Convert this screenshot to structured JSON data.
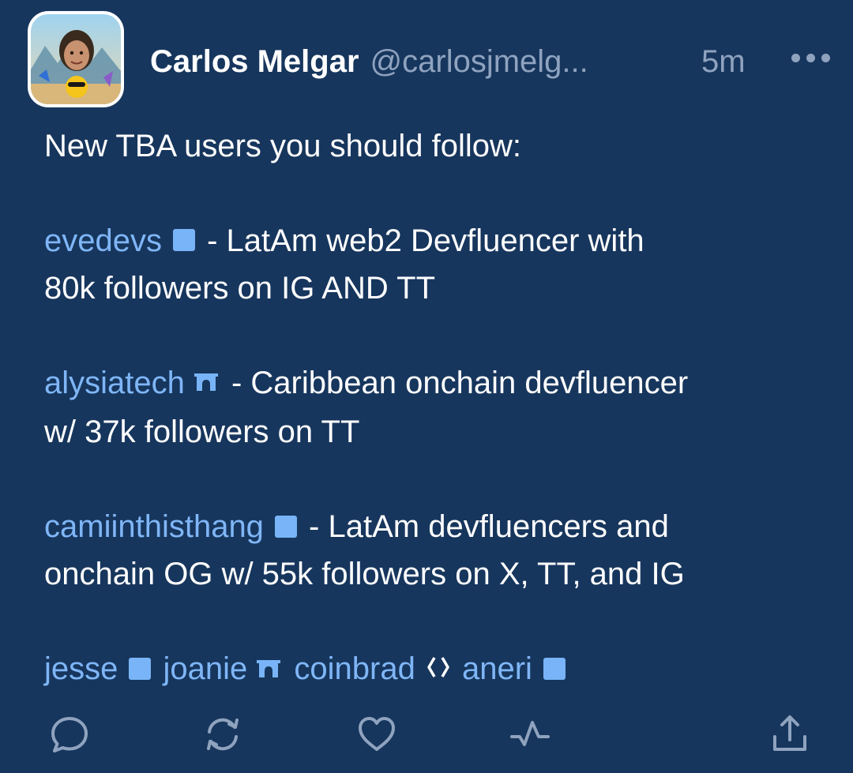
{
  "author": {
    "name": "Carlos Melgar",
    "handle": "@carlosjmelg..."
  },
  "timestamp": "5m",
  "more_icon": "more-horizontal-icon",
  "post": {
    "intro": "New TBA users you should follow:",
    "entries": [
      {
        "mention": "evedevs",
        "badge": "square",
        "text_line1": " - LatAm web2 Devfluencer with",
        "text_line2": "80k followers on IG AND TT"
      },
      {
        "mention": "alysiatech",
        "badge": "arch",
        "text_line1": " - Caribbean onchain devfluencer",
        "text_line2": "w/ 37k followers on TT"
      },
      {
        "mention": "camiinthisthang",
        "badge": "square",
        "text_line1": " - LatAm devfluencers and",
        "text_line2": "onchain OG w/ 55k followers on X, TT, and IG"
      }
    ],
    "tail_mentions": [
      {
        "mention": "jesse",
        "badge": "square"
      },
      {
        "mention": "joanie",
        "badge": "arch"
      },
      {
        "mention": "coinbrad",
        "badge": "diamond"
      },
      {
        "mention": "aneri",
        "badge": "square"
      }
    ]
  },
  "actions": [
    {
      "name": "reply",
      "icon": "comment-icon"
    },
    {
      "name": "recast",
      "icon": "recast-icon"
    },
    {
      "name": "like",
      "icon": "heart-icon"
    },
    {
      "name": "activity",
      "icon": "pulse-icon"
    },
    {
      "name": "share",
      "icon": "share-icon"
    }
  ],
  "colors": {
    "background": "#17365d",
    "text": "#ffffff",
    "muted": "#8fa3bf",
    "mention": "#7fb6f7",
    "badge": "#78b4f7"
  }
}
